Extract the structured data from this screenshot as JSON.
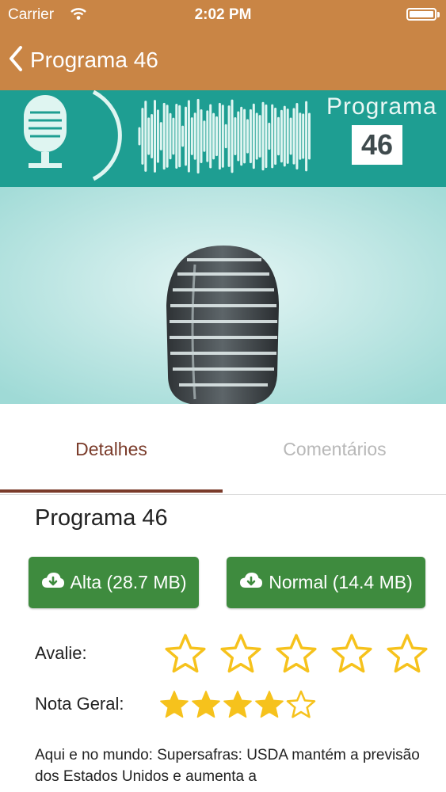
{
  "status": {
    "carrier": "Carrier",
    "time": "2:02 PM"
  },
  "nav": {
    "back_icon": "chevron-left-icon",
    "title": "Programa 46"
  },
  "hero": {
    "label": "Programa",
    "number": "46"
  },
  "tabs": [
    {
      "label": "Detalhes",
      "active": true
    },
    {
      "label": "Comentários",
      "active": false
    }
  ],
  "episode": {
    "title": "Programa 46"
  },
  "downloads": [
    {
      "label": "Alta (28.7 MB)",
      "icon": "cloud-download-icon"
    },
    {
      "label": "Normal (14.4 MB)",
      "icon": "cloud-download-icon"
    }
  ],
  "rating": {
    "label": "Avalie:",
    "max": 5,
    "value": 0
  },
  "overall": {
    "label": "Nota Geral:",
    "max": 5,
    "value": 4
  },
  "description": "Aqui e no mundo: Supersafras: USDA mantém a previsão dos Estados Unidos e aumenta a",
  "colors": {
    "header": "#c98545",
    "button": "#3e8b3e",
    "active_tab": "#7a3b2a",
    "inactive_tab": "#b8b8b8",
    "star": "#f6c21c",
    "teal": "#1e9e92"
  }
}
